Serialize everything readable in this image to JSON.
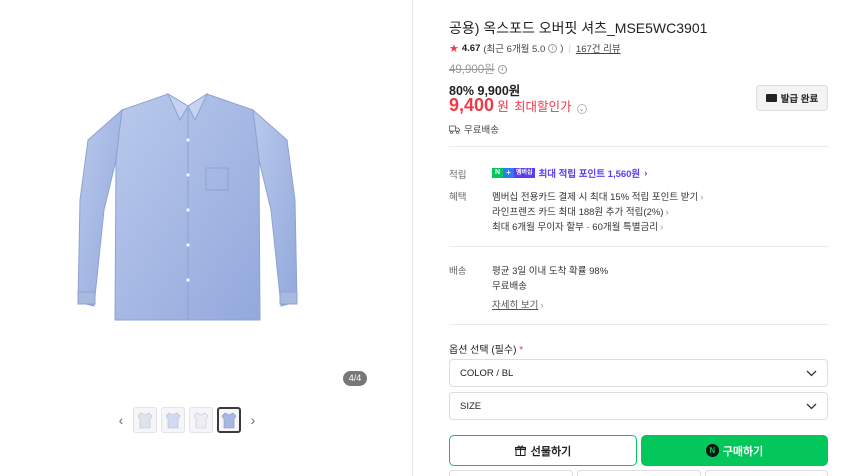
{
  "gallery": {
    "page_indicator": "4/4",
    "prev_icon": "chevron-left-icon",
    "next_icon": "chevron-right-icon",
    "thumbnail_count": 4,
    "active_thumbnail": 4
  },
  "product": {
    "title": "공용) 옥스포드 오버핏 셔츠_MSE5WC3901",
    "rating_score": "4.67",
    "rating_recent": "(최근 6개월 5.0",
    "rating_recent_close": ")",
    "review_count": "167건 리뷰"
  },
  "price": {
    "original": "49,900원",
    "discount": "80% 9,900원",
    "final_number": "9,400",
    "final_unit": "원",
    "final_label": "최대할인가",
    "coupon_button": "발급 완료",
    "free_shipping": "무료배송"
  },
  "benefits": {
    "points_label": "적립",
    "points_badge_member": "멤버십",
    "points_text": "최대 적립 포인트 1,560원",
    "benefit_label": "혜택",
    "benefit_lines": [
      "멤버십 전용카드 결제 시 최대 15% 적립 포인트 받기",
      "라인프렌즈 카드 최대 188원 추가 적립(2%)",
      "최대 6개월 무이자 할부 · 60개월 특별금리"
    ]
  },
  "delivery": {
    "label": "배송",
    "line1": "평균 3일 이내 도착 확률 98%",
    "line2": "무료배송",
    "detail_link": "자세히 보기"
  },
  "options": {
    "label": "옵션 선택 (필수)",
    "required_mark": "*",
    "color_value": "COLOR / BL",
    "size_value": "SIZE"
  },
  "actions": {
    "gift_label": "선물하기",
    "buy_label": "구매하기"
  },
  "colors": {
    "naver_green": "#03c75a",
    "sale_red": "#f03a47",
    "membership_purple": "#5b3cf0"
  }
}
